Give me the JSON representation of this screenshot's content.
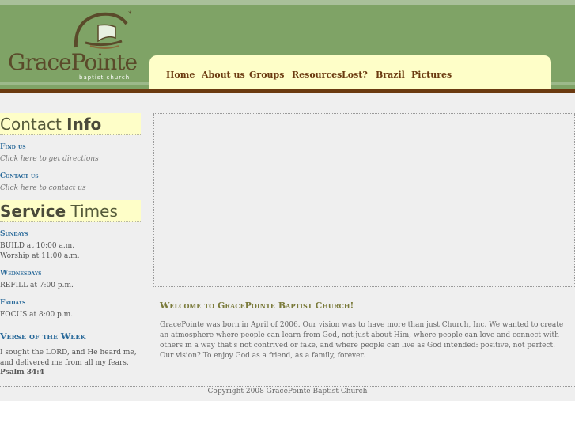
{
  "header": {
    "logo_name": "GracePointe",
    "logo_sub": "baptist church"
  },
  "nav": {
    "items": [
      "Home",
      "About us",
      "Groups",
      "Resources",
      "Lost?",
      "Brazil",
      "Pictures"
    ]
  },
  "sidebar": {
    "contact_head_light": "Contact ",
    "contact_head_bold": "Info",
    "find_us": "Find us",
    "find_us_sub": "Click here to get directions",
    "contact_us": "Contact us",
    "contact_us_sub": "Click here to contact us",
    "service_head_bold": "Service",
    "service_head_light": " Times",
    "sundays": "Sundays",
    "sundays_1": "BUILD at 10:00 a.m.",
    "sundays_2": "Worship at 11:00 a.m.",
    "wednesdays": "Wednesdays",
    "wednesdays_1": "REFILL at 7:00 p.m.",
    "fridays": "Fridays",
    "fridays_1": "FOCUS at 8:00 p.m.",
    "verse_title": "Verse of the Week",
    "verse_1": "I sought the LORD, and He heard me,",
    "verse_2": "and delivered me from all my fears.",
    "verse_ref": "Psalm 34:4"
  },
  "main": {
    "welcome_title": "Welcome to GracePointe Baptist Church!",
    "welcome_body": "GracePointe was born in April of 2006. Our vision was to have more than just Church, Inc. We wanted to create an atmosphere where people can learn from God, not just about Him, where people can love and connect with others in a way that's not contrived or fake, and where people can live as God intended: positive, not perfect. Our vision? To enjoy God as a friend, as a family, forever."
  },
  "footer": {
    "copyright": "Copyright 2008 GracePointe Baptist Church"
  },
  "colors": {
    "header_green": "#7fa366",
    "nav_cream": "#fefec8",
    "accent_brown": "#6b3a10",
    "link_blue": "#2a6a9a"
  }
}
